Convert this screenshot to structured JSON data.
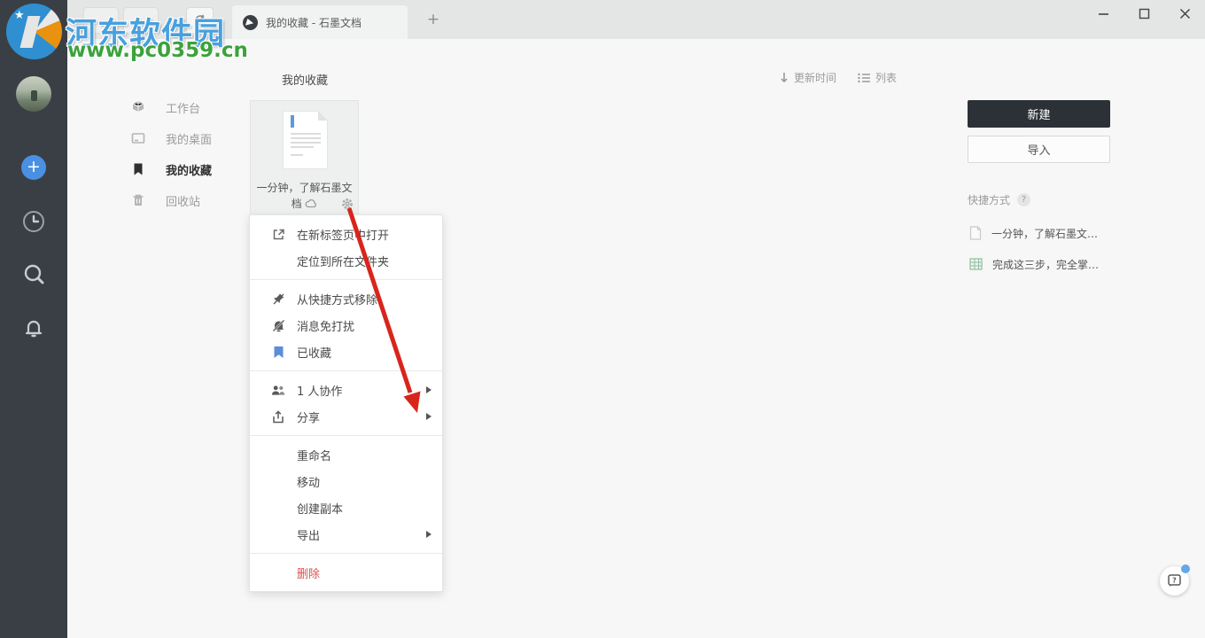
{
  "watermark": {
    "site_name": "河东软件园",
    "site_url": "www.pc0359.cn"
  },
  "titlebar": {
    "tab_title": "我的收藏 - 石墨文档",
    "new_tab_label": "+"
  },
  "left_rail": {
    "add_label": "+"
  },
  "nav": {
    "items": [
      {
        "label": "工作台",
        "icon": "workbench-icon",
        "active": false
      },
      {
        "label": "我的桌面",
        "icon": "desktop-icon",
        "active": false
      },
      {
        "label": "我的收藏",
        "icon": "bookmark-icon",
        "active": true
      },
      {
        "label": "回收站",
        "icon": "trash-icon",
        "active": false
      }
    ]
  },
  "main": {
    "title": "我的收藏",
    "sort_label": "更新时间",
    "view_label": "列表",
    "card": {
      "title_line1": "一分钟，了解石墨文",
      "title_line2": "档"
    }
  },
  "context_menu": {
    "items": [
      {
        "label": "在新标签页中打开",
        "icon": "open-new-tab-icon"
      },
      {
        "label": "定位到所在文件夹",
        "icon": null
      },
      {
        "type": "divider"
      },
      {
        "label": "从快捷方式移除",
        "icon": "pin-off-icon"
      },
      {
        "label": "消息免打扰",
        "icon": "mute-icon"
      },
      {
        "label": "已收藏",
        "icon": "bookmark-blue-icon"
      },
      {
        "type": "divider"
      },
      {
        "label": "1 人协作",
        "icon": "collaborators-icon",
        "submenu": true
      },
      {
        "label": "分享",
        "icon": "share-icon",
        "submenu": true
      },
      {
        "type": "divider"
      },
      {
        "label": "重命名",
        "icon": null
      },
      {
        "label": "移动",
        "icon": null
      },
      {
        "label": "创建副本",
        "icon": null
      },
      {
        "label": "导出",
        "icon": null,
        "submenu": true
      },
      {
        "type": "divider"
      },
      {
        "label": "删除",
        "icon": null,
        "danger": true
      }
    ]
  },
  "right_panel": {
    "new_button": "新建",
    "import_button": "导入",
    "shortcuts_title": "快捷方式",
    "shortcuts_help_badge": "?",
    "shortcuts": [
      {
        "label": "一分钟，了解石墨文…",
        "icon": "doc-icon"
      },
      {
        "label": "完成这三步，完全掌…",
        "icon": "sheet-icon"
      }
    ]
  },
  "colors": {
    "sidebar_bg": "#3a3f45",
    "accent_blue": "#4a90e2",
    "dark_button": "#2c3137",
    "danger_red": "#d9534f",
    "annotation_arrow": "#d8251c"
  }
}
